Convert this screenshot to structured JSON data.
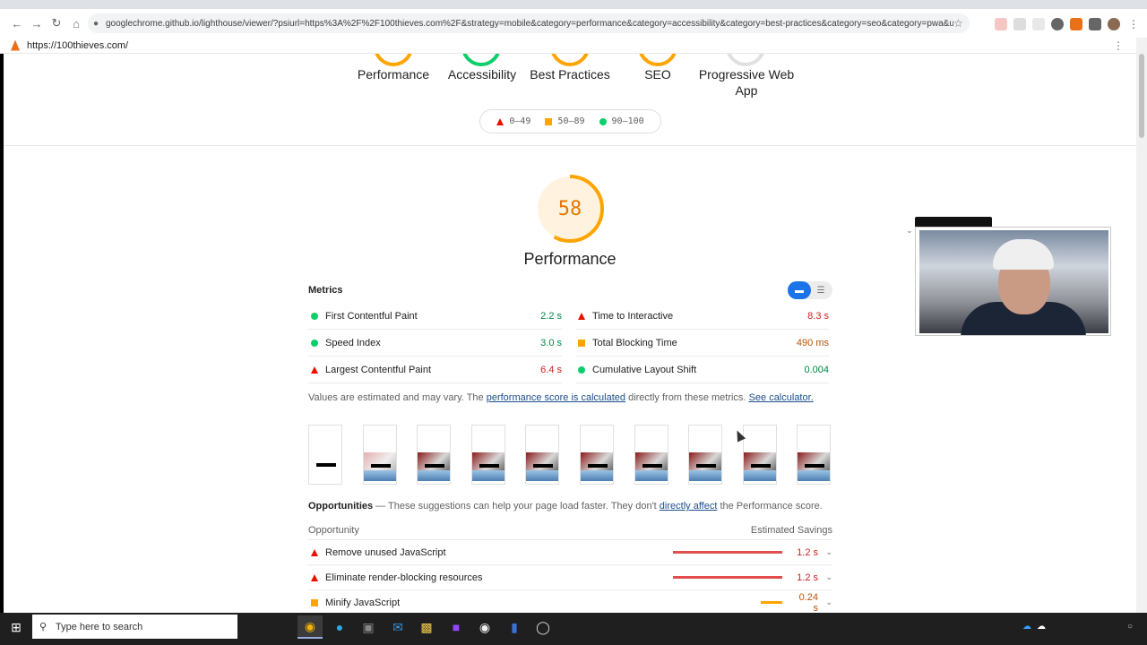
{
  "browser": {
    "url": "googlechrome.github.io/lighthouse/viewer/?psiurl=https%3A%2F%2F100thieves.com%2F&strategy=mobile&category=performance&category=accessibility&category=best-practices&category=seo&category=pwa&utm_sour...",
    "back_icon": "arrow-left",
    "forward_icon": "arrow-right",
    "reload_icon": "reload",
    "home_icon": "home"
  },
  "lighthouse": {
    "site_url": "https://100thieves.com/",
    "categories": [
      {
        "label": "Performance",
        "color": "#ffa400"
      },
      {
        "label": "Accessibility",
        "color": "#0cce6b"
      },
      {
        "label": "Best Practices",
        "color": "#ffa400"
      },
      {
        "label": "SEO",
        "color": "#ffa400"
      },
      {
        "label": "Progressive Web App",
        "color": "#cccccc"
      }
    ],
    "legend": {
      "fail": "0–49",
      "average": "50–89",
      "pass": "90–100"
    }
  },
  "performance": {
    "score": "58",
    "score_value": 58,
    "title": "Performance",
    "metrics_title": "Metrics",
    "metrics": [
      {
        "name": "First Contentful Paint",
        "value": "2.2 s",
        "status": "pass"
      },
      {
        "name": "Time to Interactive",
        "value": "8.3 s",
        "status": "fail"
      },
      {
        "name": "Speed Index",
        "value": "3.0 s",
        "status": "pass"
      },
      {
        "name": "Total Blocking Time",
        "value": "490 ms",
        "status": "average"
      },
      {
        "name": "Largest Contentful Paint",
        "value": "6.4 s",
        "status": "fail"
      },
      {
        "name": "Cumulative Layout Shift",
        "value": "0.004",
        "status": "pass"
      }
    ],
    "note_prefix": "Values are estimated and may vary. The ",
    "note_link1": "performance score is calculated",
    "note_mid": " directly from these metrics. ",
    "note_link2": "See calculator."
  },
  "opportunities": {
    "title": "Opportunities",
    "desc_prefix": " — These suggestions can help your page load faster. They don't ",
    "desc_link": "directly affect",
    "desc_suffix": " the Performance score.",
    "col_left": "Opportunity",
    "col_right": "Estimated Savings",
    "items": [
      {
        "name": "Remove unused JavaScript",
        "value": "1.2 s",
        "status": "fail",
        "savings_fraction": 1.0
      },
      {
        "name": "Eliminate render-blocking resources",
        "value": "1.2 s",
        "status": "fail",
        "savings_fraction": 1.0
      },
      {
        "name": "Minify JavaScript",
        "value": "0.24 s",
        "status": "average",
        "savings_fraction": 0.2
      }
    ]
  },
  "taskbar": {
    "search_placeholder": "Type here to search"
  },
  "colors": {
    "pass": "#0cce6b",
    "average": "#ffa400",
    "fail": "#eb0f00",
    "accent": "#1a73e8"
  }
}
